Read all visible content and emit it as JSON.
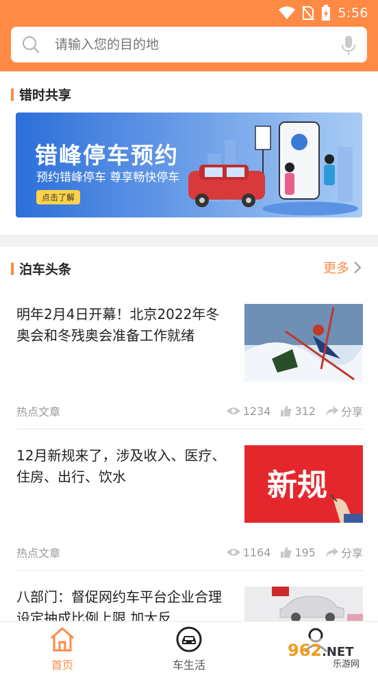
{
  "status": {
    "time": "5:56"
  },
  "search": {
    "placeholder": "请输入您的目的地"
  },
  "section1": {
    "title": "错时共享"
  },
  "banner": {
    "headline": "错峰停车预约",
    "subline": "预约错峰停车  尊享畅快停车",
    "cta": "点击了解"
  },
  "section2": {
    "title": "泊车头条",
    "more": "更多"
  },
  "articles": [
    {
      "title": "明年2月4日开幕！北京2022年冬奥会和冬残奥会准备工作就绪",
      "category": "热点文章",
      "views": "1234",
      "likes": "312",
      "share": "分享",
      "thumb_icon": "skiing-photo"
    },
    {
      "title": "12月新规来了，涉及收入、医疗、住房、出行、饮水",
      "category": "热点文章",
      "views": "1164",
      "likes": "195",
      "share": "分享",
      "thumb_text": "新规"
    },
    {
      "title": "八部门：督促网约车平台企业合理设定抽成比例上限 加大反",
      "thumb_icon": "car-photo"
    }
  ],
  "tabs": [
    {
      "label": "首页",
      "icon": "home-icon",
      "active": true
    },
    {
      "label": "车生活",
      "icon": "car-life-icon",
      "active": false
    },
    {
      "label": "",
      "icon": "profile-icon",
      "active": false
    }
  ],
  "watermark": {
    "text": "962.NET",
    "sub": "乐游网"
  },
  "colors": {
    "accent": "#ff8a45",
    "text": "#222222",
    "muted": "#9a9a9a",
    "banner_blue": "#2a6fd6"
  }
}
